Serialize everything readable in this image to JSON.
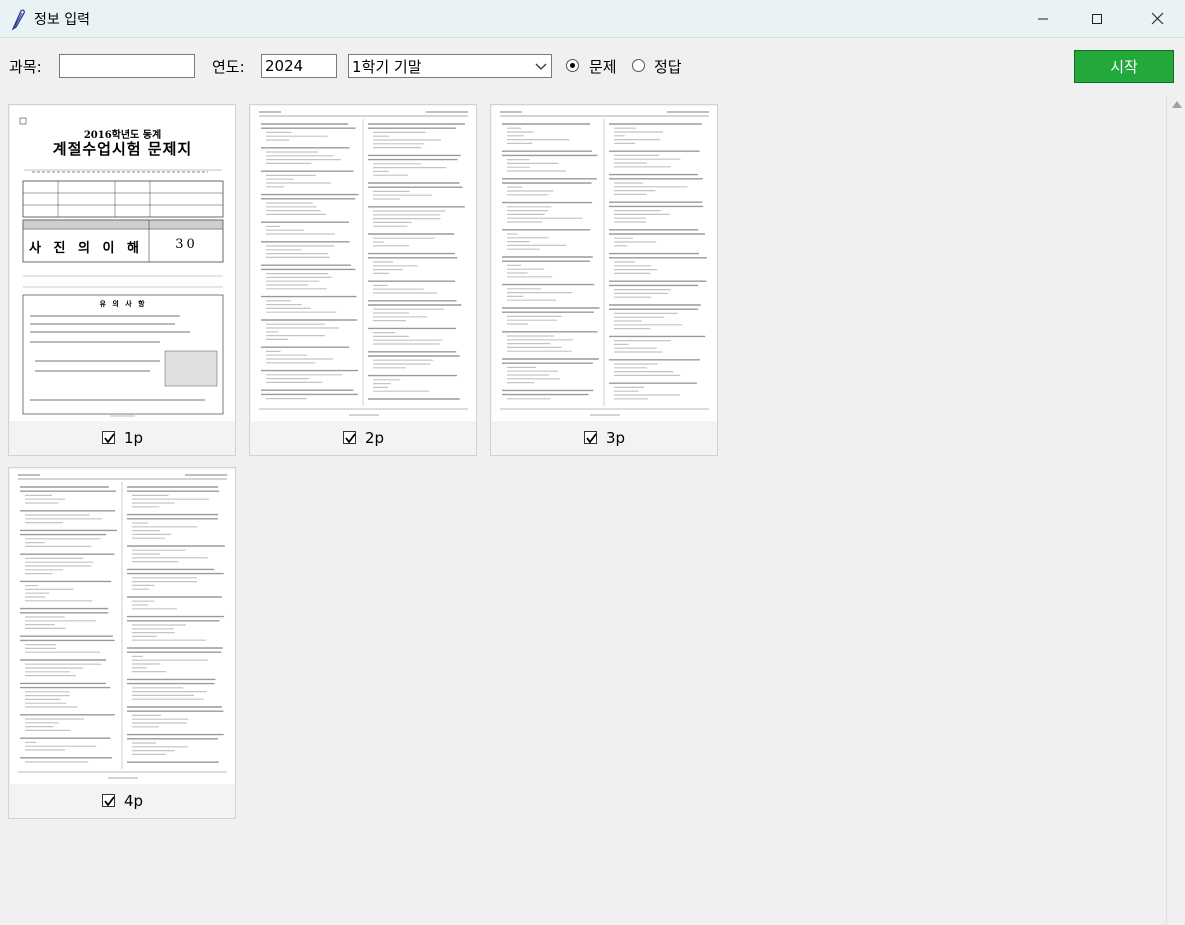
{
  "window": {
    "title": "정보 입력",
    "icon": "feather-icon"
  },
  "toolbar": {
    "subject_label": "과목:",
    "subject_value": "",
    "year_label": "연도:",
    "year_value": "2024",
    "term_value": "1학기 기말",
    "radio_question_label": "문제",
    "radio_answer_label": "정답",
    "selected_radio": "문제",
    "start_label": "시작",
    "start_color": "#22a83b"
  },
  "pages": [
    {
      "label": "1p",
      "checked": true,
      "cover": {
        "year_line": "2016학년도 동계",
        "title": "계절수업시험 문제지",
        "subject": "사 진 의 이 해",
        "code": "30",
        "notes_heading": "유 의 사 항"
      }
    },
    {
      "label": "2p",
      "checked": true
    },
    {
      "label": "3p",
      "checked": true
    },
    {
      "label": "4p",
      "checked": true
    }
  ]
}
